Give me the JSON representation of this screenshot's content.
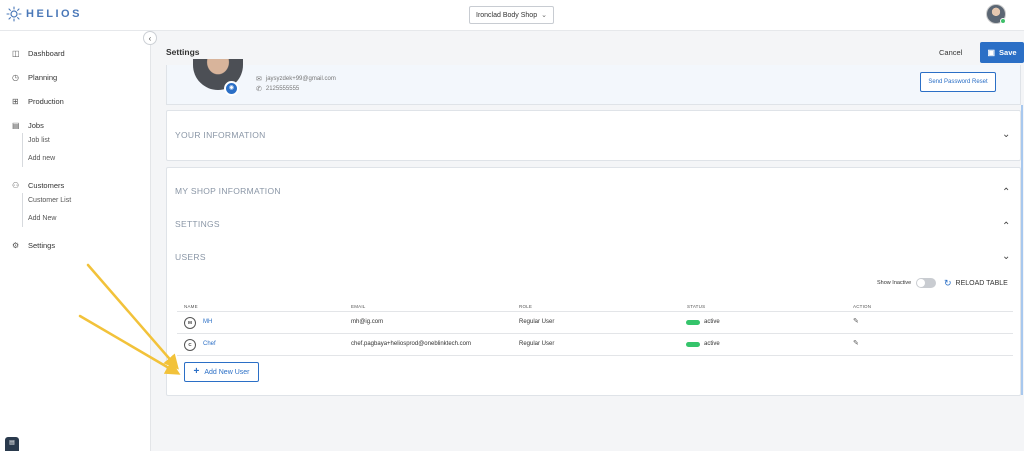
{
  "app": {
    "logo_text": "HELIOS",
    "logo_icon": "sun-icon"
  },
  "header": {
    "shop_name": "Ironclad Body Shop"
  },
  "sidebar": {
    "items": [
      {
        "label": "Dashboard",
        "icon": "dashboard-icon"
      },
      {
        "label": "Planning",
        "icon": "clock-icon"
      },
      {
        "label": "Production",
        "icon": "grid-icon"
      },
      {
        "label": "Jobs",
        "icon": "jobs-icon",
        "children": [
          "Job list",
          "Add new"
        ]
      },
      {
        "label": "Customers",
        "icon": "users-icon",
        "children": [
          "Customer List",
          "Add New"
        ]
      },
      {
        "label": "Settings",
        "icon": "gear-icon"
      }
    ]
  },
  "page": {
    "title": "Settings",
    "cancel_label": "Cancel",
    "save_label": "Save"
  },
  "profile": {
    "email": "jaysyzdek+99@gmail.com",
    "phone": "2125555555",
    "reset_label": "Send Password Reset"
  },
  "sections": {
    "your_information": "YOUR INFORMATION",
    "my_shop_information": "MY SHOP INFORMATION",
    "settings": "SETTINGS",
    "users": "USERS"
  },
  "users": {
    "show_inactive_label": "Show Inactive",
    "reload_label": "RELOAD TABLE",
    "columns": [
      "NAME",
      "EMAIL",
      "ROLE",
      "STATUS",
      "ACTION"
    ],
    "rows": [
      {
        "initial": "M",
        "name": "MH",
        "email": "mh@ig.com",
        "role": "Regular User",
        "status": "active"
      },
      {
        "initial": "C",
        "name": "Chef",
        "email": "chef.pagbaya+heliosprod@oneblinktech.com",
        "role": "Regular User",
        "status": "active"
      }
    ],
    "add_label": "Add New User"
  },
  "colors": {
    "accent": "#2b6fc6",
    "status_active": "#35c46b",
    "annotation_arrow": "#f2c23a"
  }
}
